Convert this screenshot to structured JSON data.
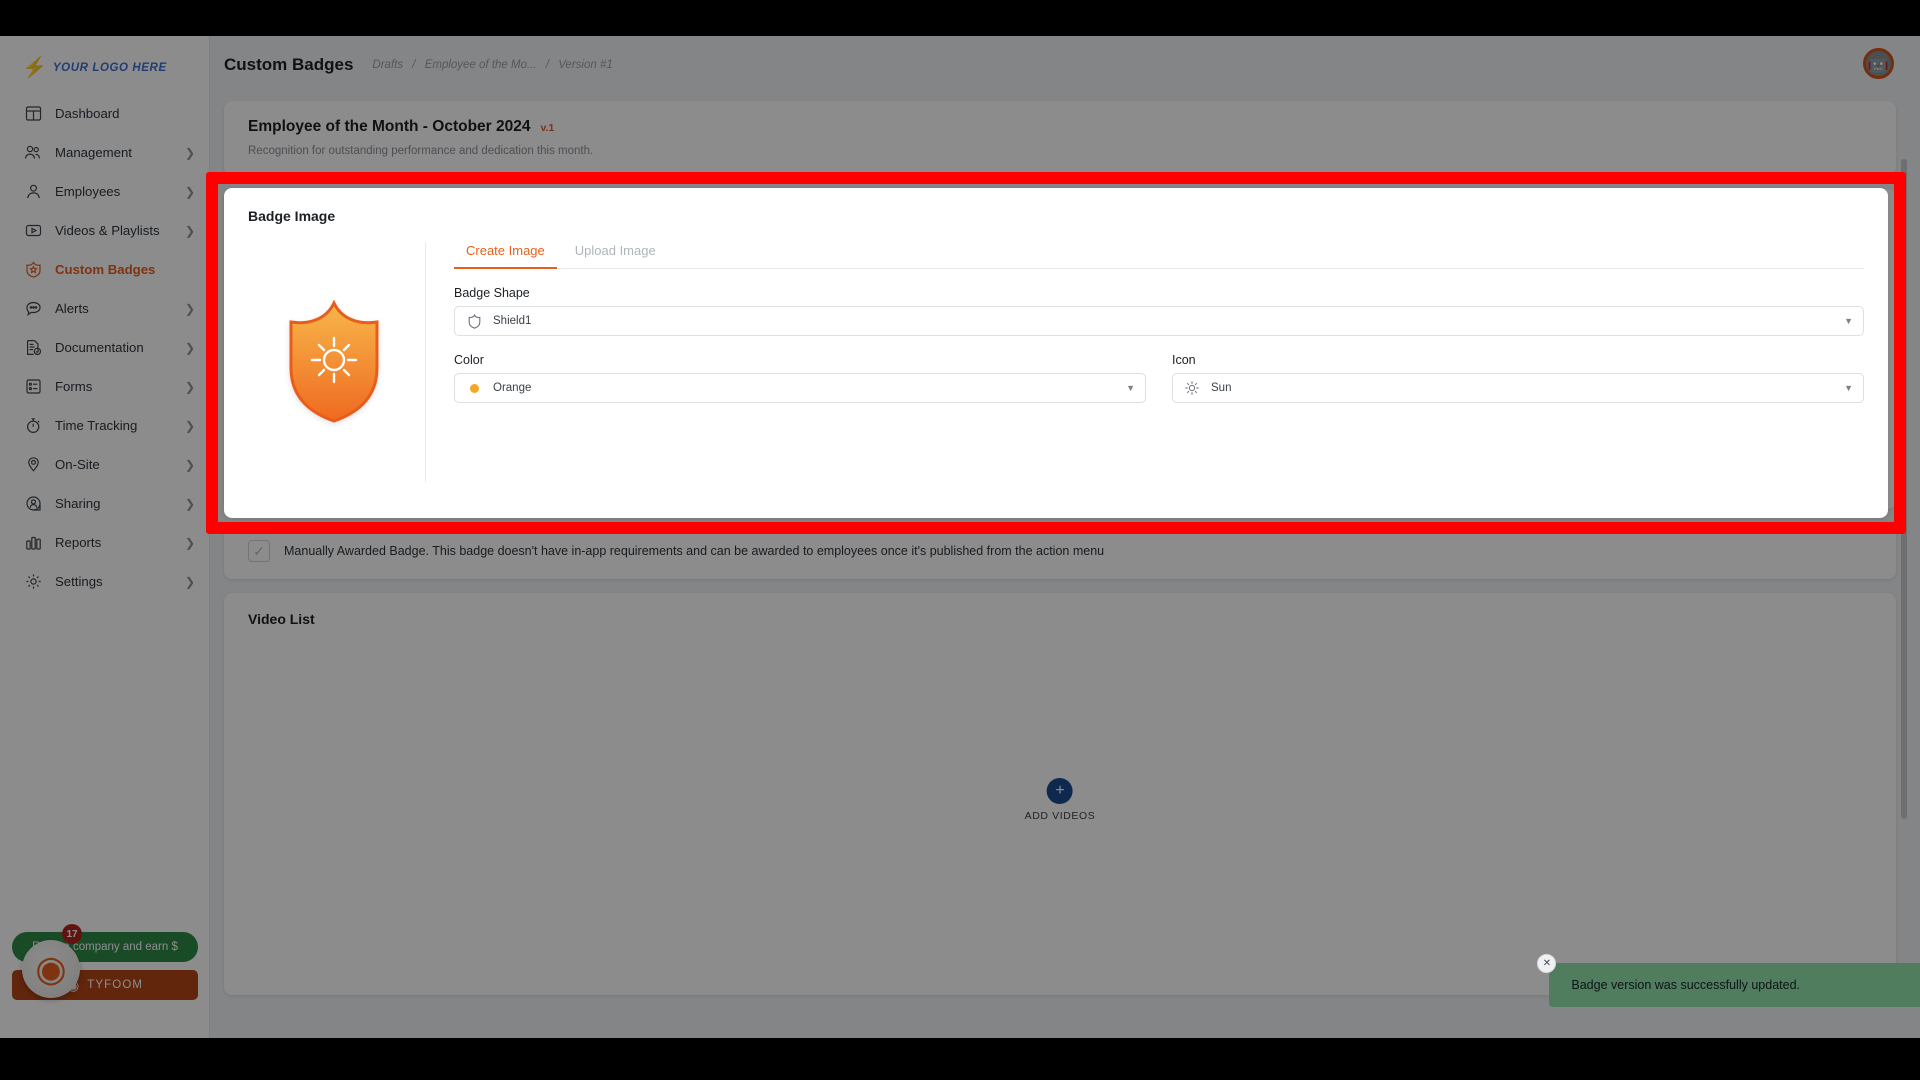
{
  "sidebar": {
    "logo_text": "YOUR LOGO HERE",
    "items": [
      {
        "label": "Dashboard",
        "icon": "dashboard-icon",
        "chevron": false,
        "active": false
      },
      {
        "label": "Management",
        "icon": "management-icon",
        "chevron": true,
        "active": false
      },
      {
        "label": "Employees",
        "icon": "employees-icon",
        "chevron": true,
        "active": false
      },
      {
        "label": "Videos & Playlists",
        "icon": "video-icon",
        "chevron": true,
        "active": false
      },
      {
        "label": "Custom Badges",
        "icon": "badge-shield-icon",
        "chevron": false,
        "active": true
      },
      {
        "label": "Alerts",
        "icon": "alerts-chat-icon",
        "chevron": true,
        "active": false
      },
      {
        "label": "Documentation",
        "icon": "document-check-icon",
        "chevron": true,
        "active": false
      },
      {
        "label": "Forms",
        "icon": "forms-list-icon",
        "chevron": true,
        "active": false
      },
      {
        "label": "Time Tracking",
        "icon": "stopwatch-icon",
        "chevron": true,
        "active": false
      },
      {
        "label": "On-Site",
        "icon": "map-pin-icon",
        "chevron": true,
        "active": false
      },
      {
        "label": "Sharing",
        "icon": "share-person-icon",
        "chevron": true,
        "active": false
      },
      {
        "label": "Reports",
        "icon": "bar-chart-icon",
        "chevron": true,
        "active": false
      },
      {
        "label": "Settings",
        "icon": "gear-icon",
        "chevron": true,
        "active": false
      }
    ],
    "promo": {
      "green_label": "Refer a company and earn $",
      "badge_count": "17",
      "brand_label": "TYFOOM"
    }
  },
  "header": {
    "title": "Custom Badges",
    "breadcrumb": [
      "Drafts",
      "Employee of the Mo...",
      "Version #1"
    ],
    "breadcrumb_separator": "/"
  },
  "badge_header": {
    "title": "Employee of the Month - October 2024",
    "version": "v.1",
    "description": "Recognition for outstanding performance and dedication this month."
  },
  "badge_image": {
    "section_title": "Badge Image",
    "tabs": [
      {
        "label": "Create Image",
        "active": true
      },
      {
        "label": "Upload Image",
        "active": false
      }
    ],
    "badge_shape": {
      "label": "Badge Shape",
      "value": "Shield1",
      "icon": "shield-outline-icon"
    },
    "color": {
      "label": "Color",
      "value": "Orange",
      "swatch_hex": "#f5a623"
    },
    "icon_field": {
      "label": "Icon",
      "value": "Sun",
      "icon": "sun-icon"
    },
    "preview": {
      "shape": "shield",
      "icon": "sun-icon",
      "gradient_from": "#f7b64a",
      "gradient_to": "#ef6a21"
    }
  },
  "manual_award": {
    "checked": false,
    "label": "Manually Awarded Badge. This badge doesn't have in-app requirements and can be awarded to employees once it's published from the action menu"
  },
  "video_list": {
    "section_title": "Video List",
    "add_label": "ADD VIDEOS",
    "add_icon": "plus-icon"
  },
  "toast": {
    "message": "Badge version was successfully updated.",
    "close_icon": "close-icon",
    "background_hex": "#4f7d5d"
  },
  "colors": {
    "accent": "#e8601c",
    "highlight": "#ff0000",
    "primary_blue": "#1c4b8f"
  }
}
